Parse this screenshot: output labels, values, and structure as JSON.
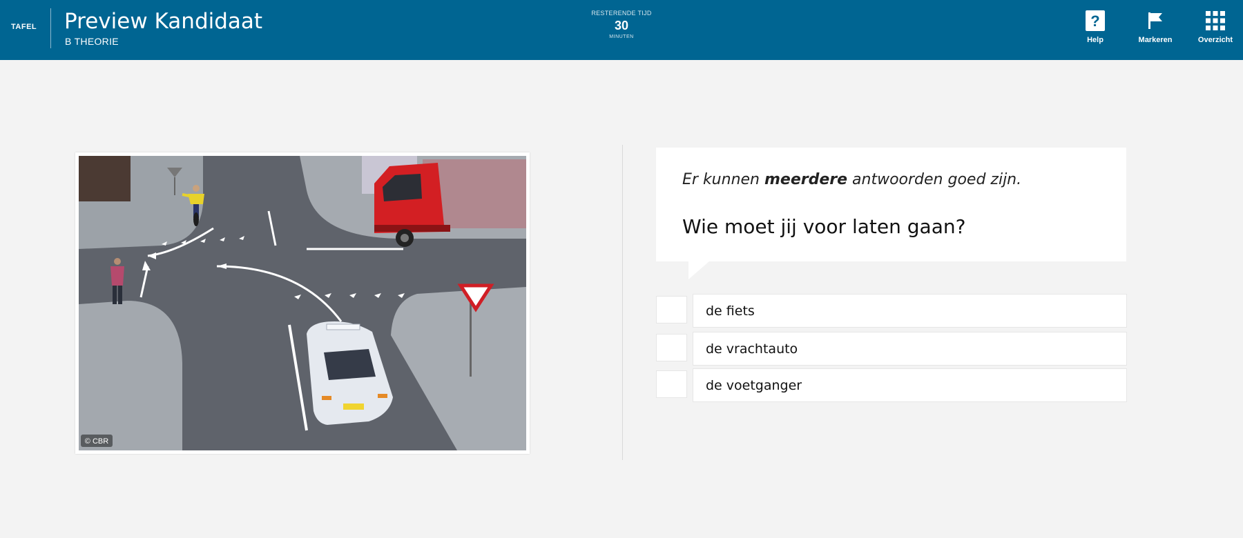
{
  "header": {
    "tafel": "TAFEL",
    "title": "Preview Kandidaat",
    "subtitle": "B THEORIE",
    "timer_label": "RESTERENDE TIJD",
    "timer_value": "30",
    "timer_unit": "MINUTEN",
    "buttons": [
      {
        "label": "Help",
        "icon": "help-icon"
      },
      {
        "label": "Markeren",
        "icon": "flag-icon"
      },
      {
        "label": "Overzicht",
        "icon": "grid-icon"
      }
    ],
    "colors": {
      "bar": "#006592",
      "text": "#ffffff"
    }
  },
  "image": {
    "copyright": "© CBR"
  },
  "question": {
    "instruction_pre": "Er kunnen ",
    "instruction_bold": "meerdere",
    "instruction_post": " antwoorden goed zijn.",
    "text": "Wie moet jij voor laten gaan?"
  },
  "answers": [
    {
      "label": "de fiets"
    },
    {
      "label": "de vrachtauto"
    },
    {
      "label": "de voetganger"
    }
  ]
}
